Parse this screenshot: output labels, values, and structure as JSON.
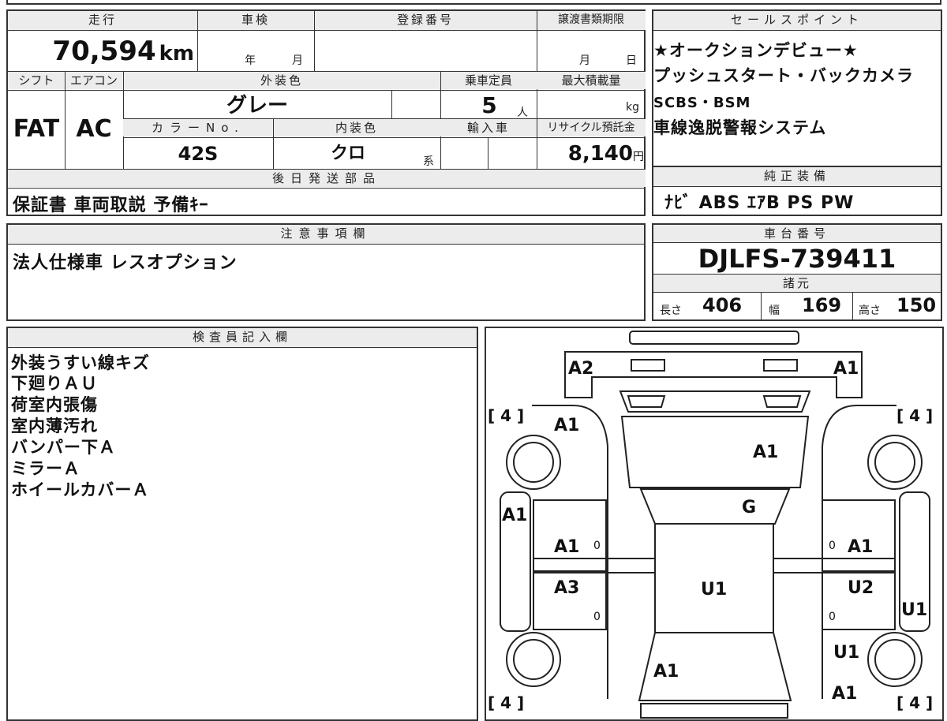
{
  "main": {
    "mileage_label": "走行",
    "mileage": "70,594",
    "mileage_unit": "km",
    "inspection_label": "車検",
    "inspection_year": "年",
    "inspection_month": "月",
    "registration_label": "登録番号",
    "transfer_label": "譲渡書類期限",
    "transfer_month": "月",
    "transfer_day": "日",
    "shift_label": "シフト",
    "shift": "FAT",
    "ac_label": "エアコン",
    "ac": "AC",
    "exterior_label": "外装色",
    "exterior": "グレー",
    "capacity_label": "乗車定員",
    "capacity": "5",
    "capacity_unit": "人",
    "load_label": "最大積載量",
    "load_unit": "kg",
    "color_no_label": "カラーNo.",
    "color_no": "42S",
    "interior_label": "内装色",
    "interior": "クロ",
    "interior_suffix": "系",
    "import_label": "輸入車",
    "recycle_label": "リサイクル預託金",
    "recycle": "8,140",
    "recycle_unit": "円",
    "later_label": "後日発送部品",
    "later": "保証書 車両取説 予備ｷｰ"
  },
  "sales": {
    "label": "セールスポイント",
    "lines": [
      "★オークションデビュー★",
      "プッシュスタート・バックカメラ",
      "SCBS・BSM",
      "車線逸脱警報システム"
    ]
  },
  "equipment": {
    "label": "純正装備",
    "value": "ﾅﾋﾞ ABS ｴｱB PS PW"
  },
  "notes": {
    "label": "注意事項欄",
    "value": "法人仕様車 レスオプション"
  },
  "chassis": {
    "label": "車台番号",
    "value": "DJLFS-739411",
    "specs_label": "諸元",
    "length_label": "長さ",
    "length": "406",
    "width_label": "幅",
    "width": "169",
    "height_label": "高さ",
    "height": "150"
  },
  "inspector": {
    "label": "検査員記入欄",
    "lines": [
      "外装うすい線キズ",
      "下廻りＡＵ",
      "荷室内張傷",
      "室内薄汚れ",
      "バンパー下Ａ",
      "ミラーＡ",
      "ホイールカバーＡ"
    ]
  },
  "diagram": {
    "marks": {
      "front_left": "A2",
      "front_right": "A1",
      "fender_left": "A1",
      "hood": "A1",
      "windshield": "G",
      "side_left": "A1",
      "door_fl": "A1",
      "door_fr": "A1",
      "door_rl": "A3",
      "roof": "U1",
      "door_rr": "U2",
      "side_right": "U1",
      "quarter_right": "U1",
      "trunk": "A1",
      "rear_right": "A1"
    },
    "tires": [
      "[ 4 ]",
      "[ 4 ]",
      "[ 4 ]",
      "[ 4 ]"
    ],
    "zeros": [
      "0",
      "0",
      "0",
      "0"
    ]
  }
}
